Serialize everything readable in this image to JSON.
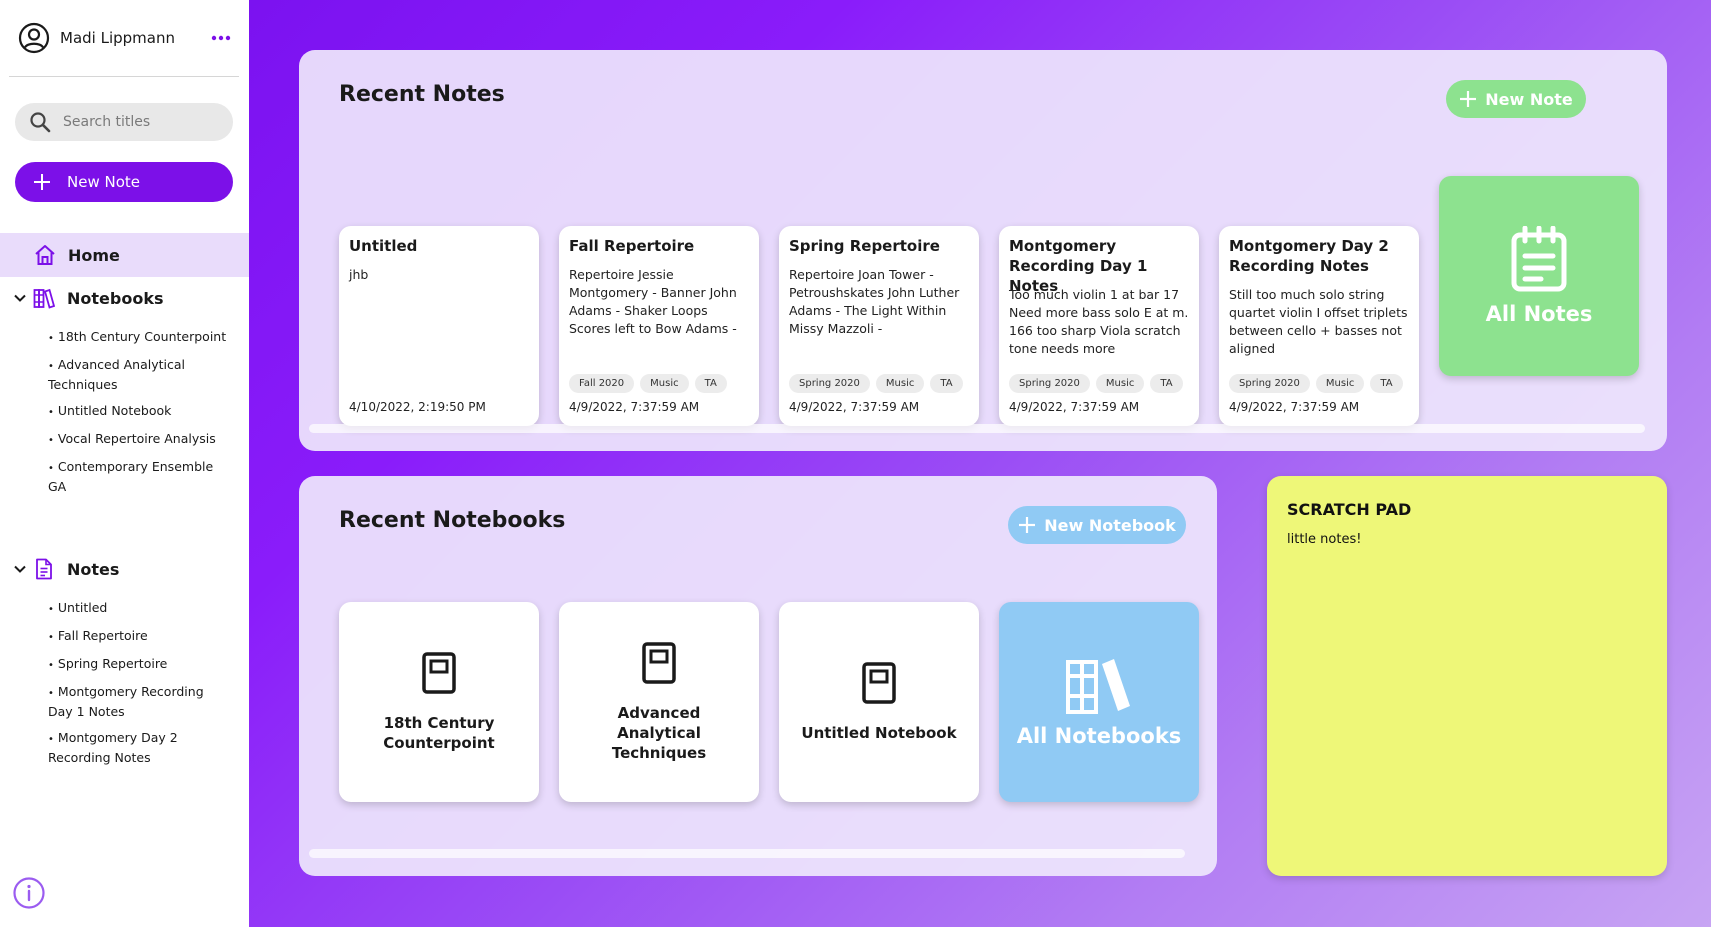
{
  "user": {
    "name": "Madi Lippmann"
  },
  "sidebar": {
    "search_placeholder": "Search titles",
    "new_note_label": "New Note",
    "home_label": "Home",
    "notebooks_label": "Notebooks",
    "notebooks": [
      {
        "label": "18th Century Counterpoint"
      },
      {
        "label": "Advanced Analytical Techniques"
      },
      {
        "label": "Untitled Notebook"
      },
      {
        "label": "Vocal Repertoire Analysis"
      },
      {
        "label": "Contemporary Ensemble GA"
      }
    ],
    "notes_label": "Notes",
    "notes": [
      {
        "label": "Untitled"
      },
      {
        "label": "Fall Repertoire"
      },
      {
        "label": "Spring Repertoire"
      },
      {
        "label": "Montgomery Recording Day 1 Notes"
      },
      {
        "label": "Montgomery Day 2 Recording Notes"
      }
    ]
  },
  "recent_notes": {
    "title": "Recent Notes",
    "new_button_label": "New Note",
    "all_label": "All Notes",
    "cards": [
      {
        "title": "Untitled",
        "body": "jhb",
        "tags": [],
        "date": "4/10/2022, 2:19:50 PM"
      },
      {
        "title": "Fall Repertoire",
        "body": "Repertoire Jessie Montgomery - Banner John Adams - Shaker Loops Scores left to Bow Adams -",
        "tags": [
          "Fall 2020",
          "Music",
          "TA"
        ],
        "date": "4/9/2022, 7:37:59 AM"
      },
      {
        "title": "Spring Repertoire",
        "body": "Repertoire Joan Tower - Petroushskates John Luther Adams - The Light Within Missy Mazzoli -",
        "tags": [
          "Spring 2020",
          "Music",
          "TA"
        ],
        "date": "4/9/2022, 7:37:59 AM"
      },
      {
        "title": "Montgomery Recording Day 1 Notes",
        "body": "Too much violin 1 at bar 17 Need more bass solo E at m. 166 too sharp Viola scratch tone needs more",
        "tags": [
          "Spring 2020",
          "Music",
          "TA"
        ],
        "date": "4/9/2022, 7:37:59 AM"
      },
      {
        "title": "Montgomery Day 2 Recording Notes",
        "body": "Still too much solo string quartet violin I offset triplets between cello + basses not aligned",
        "tags": [
          "Spring 2020",
          "Music",
          "TA"
        ],
        "date": "4/9/2022, 7:37:59 AM"
      }
    ]
  },
  "recent_notebooks": {
    "title": "Recent Notebooks",
    "new_button_label": "New Notebook",
    "all_label": "All Notebooks",
    "cards": [
      {
        "label": "18th Century Counterpoint"
      },
      {
        "label": "Advanced Analytical Techniques"
      },
      {
        "label": "Untitled Notebook"
      }
    ]
  },
  "scratch_pad": {
    "title": "SCRATCH PAD",
    "content": "little notes!"
  },
  "colors": {
    "accent": "#7c10e8",
    "notes_green": "#8de28f",
    "notebooks_blue": "#90caf4",
    "scratch_yellow": "#eef778",
    "home_highlight": "#e9dcfb"
  },
  "icons": {
    "avatar": "user-circle-icon",
    "more": "more-dots-icon",
    "search": "search-icon",
    "plus": "plus-icon",
    "home": "home-icon",
    "notebooks": "notebooks-icon",
    "notes": "note-doc-icon",
    "info": "info-icon",
    "all_notes": "notepad-icon",
    "all_notebooks": "books-icon",
    "notebook": "notebook-icon"
  }
}
